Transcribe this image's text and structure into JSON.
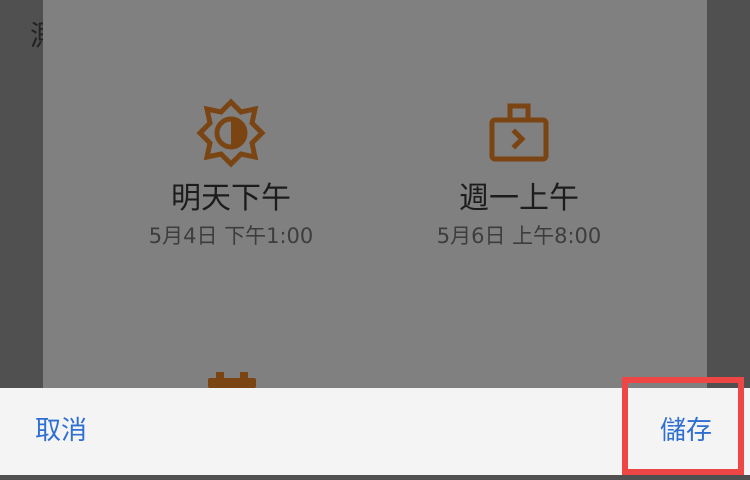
{
  "background": {
    "partial_text": "測"
  },
  "options": [
    {
      "icon": "sun-half-icon",
      "title": "明天下午",
      "subtitle": "5月4日 下午1:00"
    },
    {
      "icon": "briefcase-icon",
      "title": "週一上午",
      "subtitle": "5月6日 上午8:00"
    },
    {
      "icon": "calendar-icon",
      "title": "",
      "subtitle": ""
    }
  ],
  "footer": {
    "cancel_label": "取消",
    "save_label": "儲存"
  },
  "colors": {
    "accent": "#2f6fd1",
    "icon": "#7a4512",
    "highlight": "#ee4545",
    "overlay": "#808080"
  }
}
